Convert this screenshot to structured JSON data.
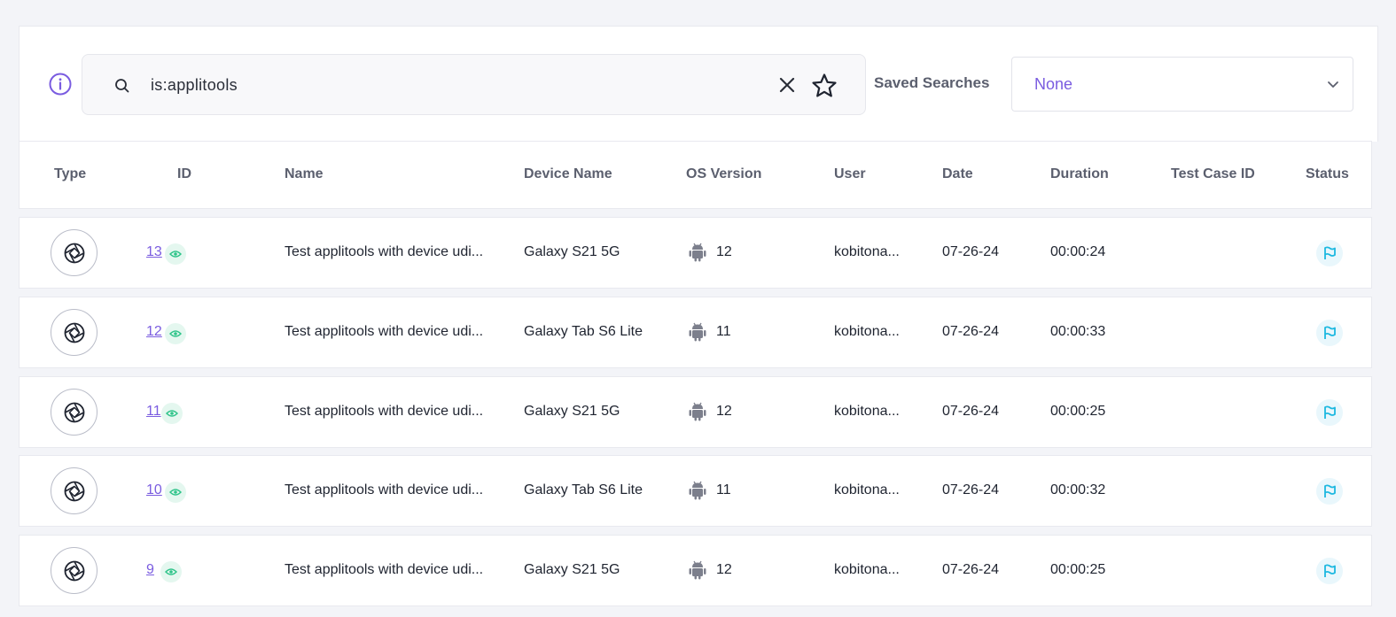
{
  "search": {
    "query": "is:applitools",
    "saved_searches_label": "Saved Searches",
    "saved_searches_value": "None"
  },
  "icons": {
    "info": "info-icon",
    "search": "search-icon",
    "clear": "close-icon",
    "favorite": "star-icon",
    "dropdown": "chevron-down-icon",
    "type": "aperture-icon",
    "view": "eye-icon",
    "os": "android-icon",
    "status": "flag-icon"
  },
  "colors": {
    "accent": "#7a5ce0",
    "view_green": "#2fc48a",
    "status_cyan": "#1cb8e0"
  },
  "table": {
    "headers": {
      "type": "Type",
      "id": "ID",
      "name": "Name",
      "device": "Device Name",
      "os": "OS Version",
      "user": "User",
      "date": "Date",
      "duration": "Duration",
      "test_case_id": "Test Case ID",
      "status": "Status"
    },
    "rows": [
      {
        "id": "13",
        "name": "Test applitools with device udi...",
        "device": "Galaxy S21 5G",
        "os": "12",
        "user": "kobitona...",
        "date": "07-26-24",
        "duration": "00:00:24",
        "test_case_id": ""
      },
      {
        "id": "12",
        "name": "Test applitools with device udi...",
        "device": "Galaxy Tab S6 Lite",
        "os": "11",
        "user": "kobitona...",
        "date": "07-26-24",
        "duration": "00:00:33",
        "test_case_id": ""
      },
      {
        "id": "11",
        "name": "Test applitools with device udi...",
        "device": "Galaxy S21 5G",
        "os": "12",
        "user": "kobitona...",
        "date": "07-26-24",
        "duration": "00:00:25",
        "test_case_id": ""
      },
      {
        "id": "10",
        "name": "Test applitools with device udi...",
        "device": "Galaxy Tab S6 Lite",
        "os": "11",
        "user": "kobitona...",
        "date": "07-26-24",
        "duration": "00:00:32",
        "test_case_id": ""
      },
      {
        "id": "9",
        "name": "Test applitools with device udi...",
        "device": "Galaxy S21 5G",
        "os": "12",
        "user": "kobitona...",
        "date": "07-26-24",
        "duration": "00:00:25",
        "test_case_id": ""
      }
    ]
  }
}
